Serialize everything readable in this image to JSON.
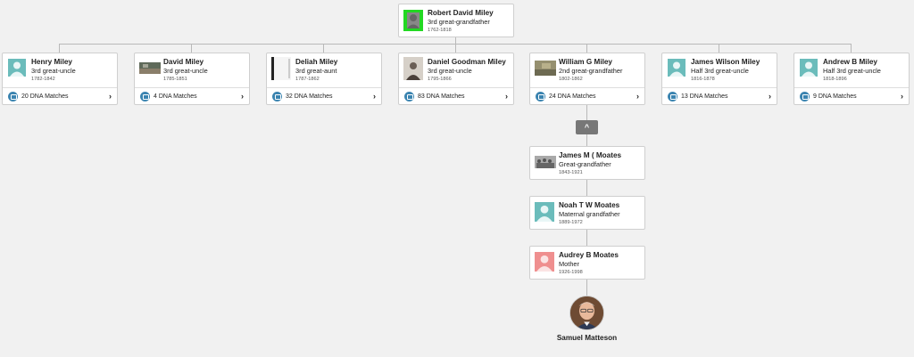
{
  "root": {
    "name": "Robert David Miley",
    "relation": "3rd great-grandfather",
    "years": "1762-1818",
    "photo": "green"
  },
  "siblings": [
    {
      "id": "henry",
      "name": "Henry Miley",
      "relation": "3rd great-uncle",
      "years": "1782-1842",
      "photo": "silhouette-teal",
      "dna_label": "20 DNA Matches"
    },
    {
      "id": "david",
      "name": "David Miley",
      "relation": "3rd great-uncle",
      "years": "1785-1851",
      "photo": "photo-landscape",
      "dna_label": "4 DNA Matches"
    },
    {
      "id": "deliah",
      "name": "Deliah Miley",
      "relation": "3rd great-aunt",
      "years": "1787-1862",
      "photo": "photo-document",
      "dna_label": "32 DNA Matches"
    },
    {
      "id": "daniel",
      "name": "Daniel Goodman Miley",
      "relation": "3rd great-uncle",
      "years": "1795-1866",
      "photo": "photo-portrait",
      "dna_label": "83 DNA Matches"
    },
    {
      "id": "william",
      "name": "William G Miley",
      "relation": "2nd great-grandfather",
      "years": "1802-1862",
      "photo": "photo-landscape2",
      "dna_label": "24 DNA Matches"
    },
    {
      "id": "james-wilson",
      "name": "James Wilson Miley",
      "relation": "Half 3rd great-uncle",
      "years": "1816-1878",
      "photo": "silhouette-teal",
      "dna_label": "13 DNA Matches"
    },
    {
      "id": "andrew",
      "name": "Andrew B Miley",
      "relation": "Half 3rd great-uncle",
      "years": "1818-1896",
      "photo": "silhouette-teal",
      "dna_label": "9 DNA Matches"
    }
  ],
  "lineage": [
    {
      "id": "james-m",
      "name": "James M ( Moates",
      "relation": "Great-grandfather",
      "years": "1843-1921",
      "photo": "photo-group"
    },
    {
      "id": "noah",
      "name": "Noah T W Moates",
      "relation": "Maternal grandfather",
      "years": "1889-1972",
      "photo": "silhouette-teal"
    },
    {
      "id": "audrey",
      "name": "Audrey B Moates",
      "relation": "Mother",
      "years": "1926-1998",
      "photo": "silhouette-pink"
    }
  ],
  "collapse_icon": "^",
  "self": {
    "name": "Samuel Matteson"
  },
  "colors": {
    "silhouette_teal": "#6bbcbb",
    "silhouette_pink": "#ef8f8f",
    "root_photo": "#22d822",
    "dna_icon": "#3b84b0"
  }
}
